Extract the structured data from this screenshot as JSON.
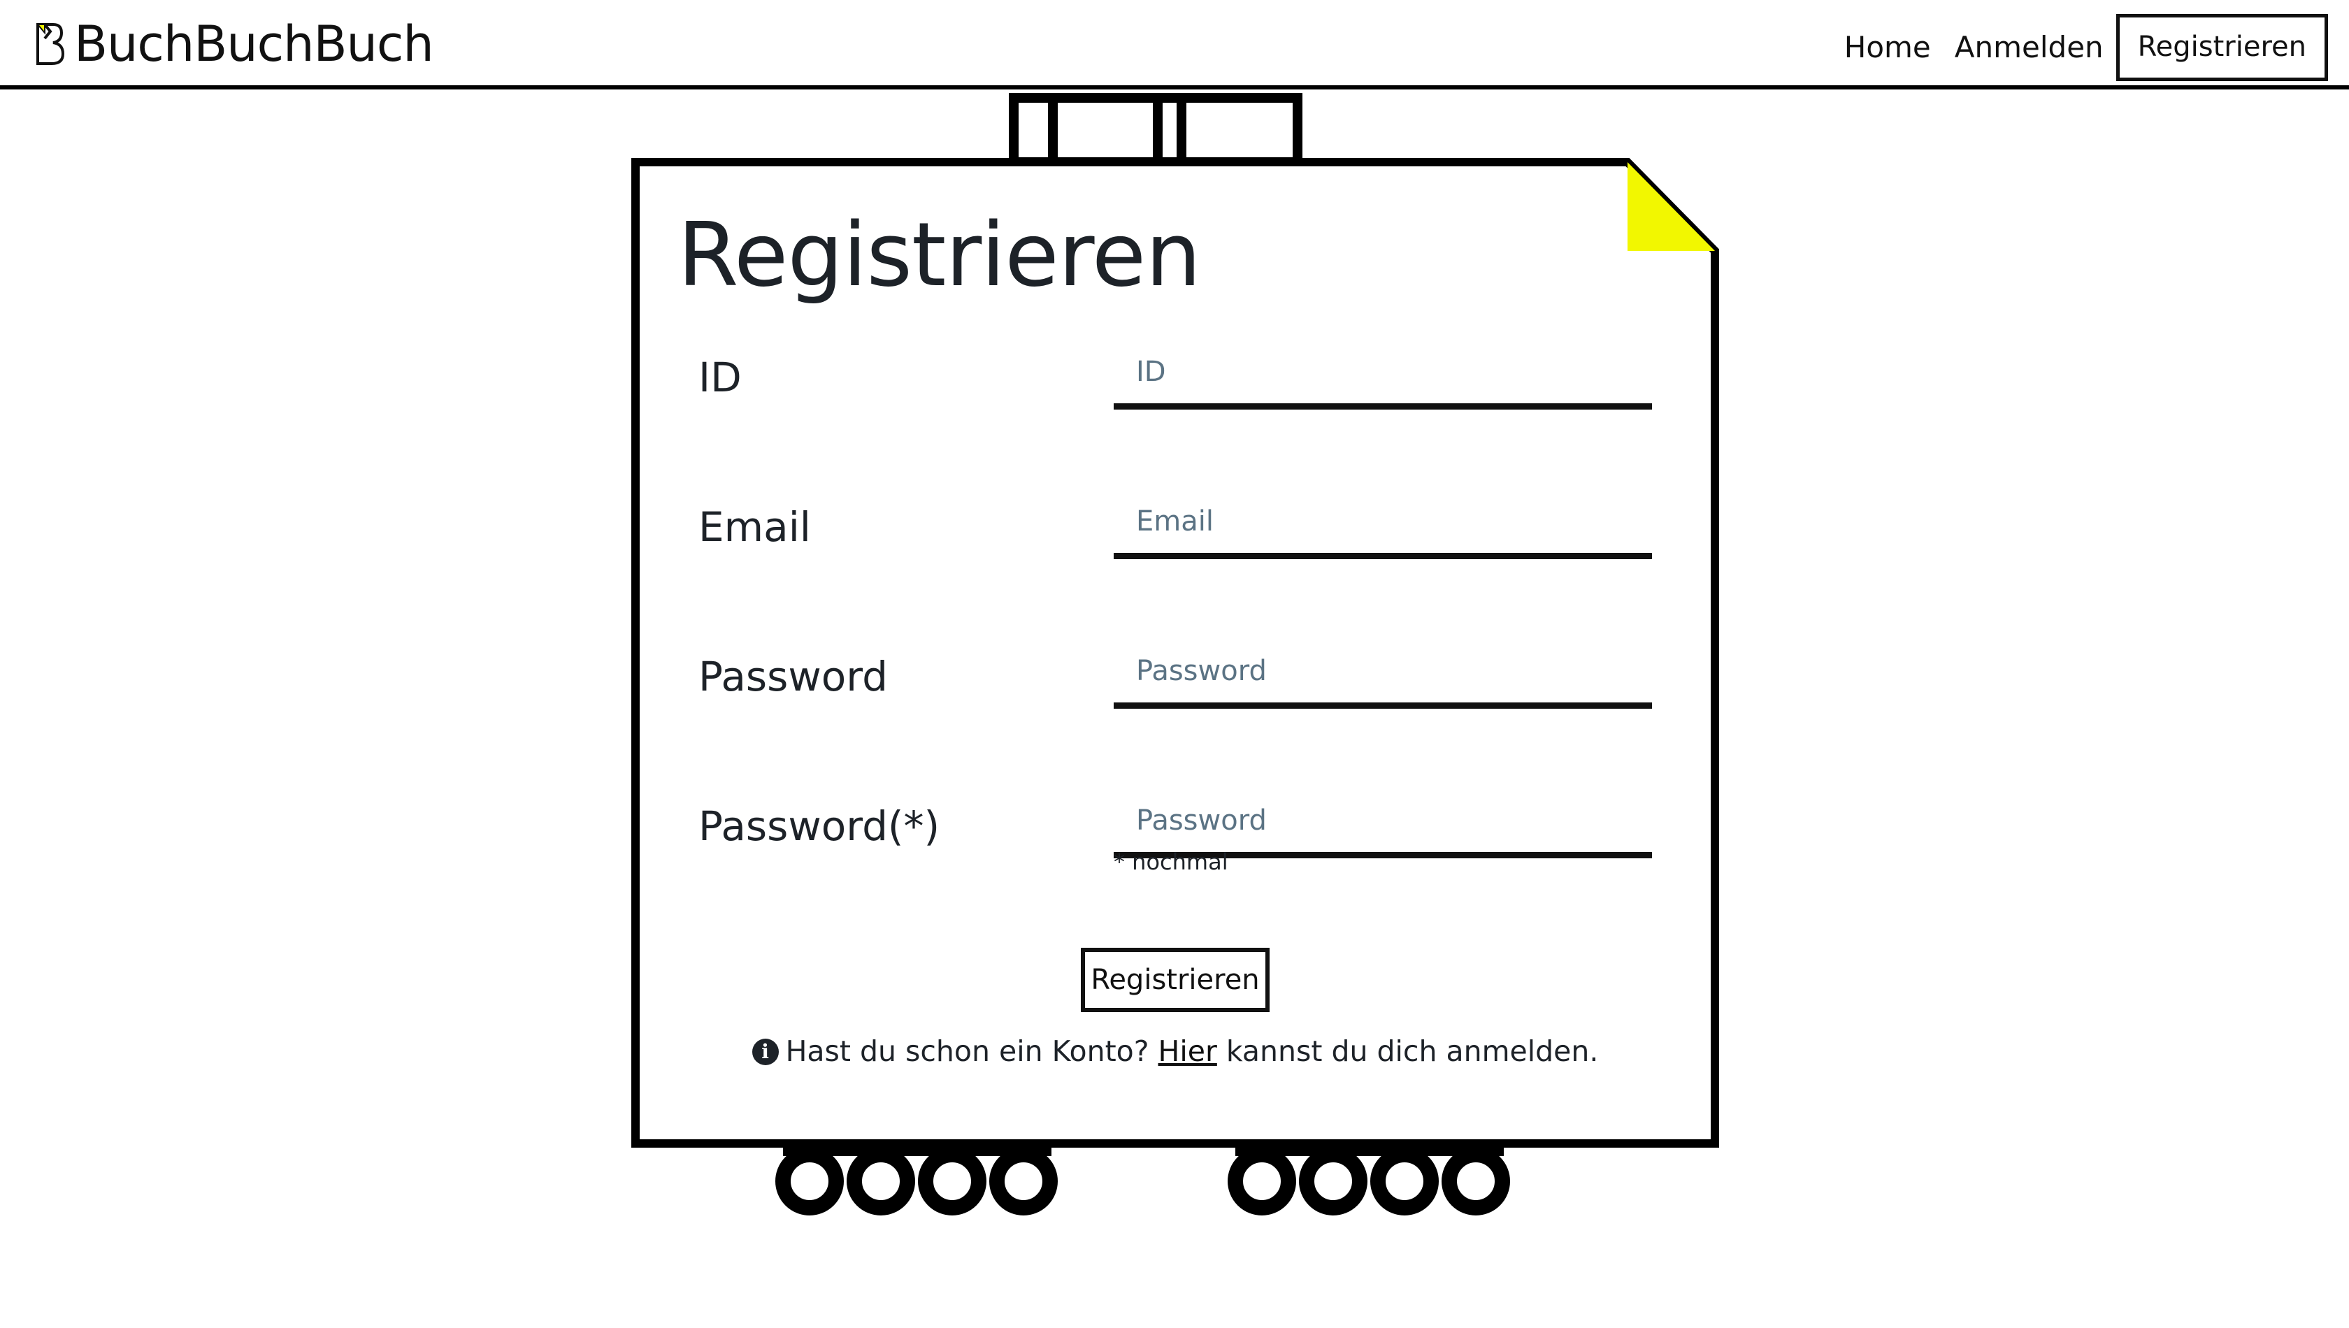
{
  "brand": {
    "name": "BuchBuchBuch"
  },
  "nav": {
    "home": "Home",
    "login": "Anmelden",
    "register": "Registrieren"
  },
  "form": {
    "title": "Registrieren",
    "fields": [
      {
        "label": "ID",
        "placeholder": "ID"
      },
      {
        "label": "Email",
        "placeholder": "Email"
      },
      {
        "label": "Password",
        "placeholder": "Password"
      },
      {
        "label": "Password(*)",
        "placeholder": "Password"
      }
    ],
    "hint": "* nochmal",
    "submit": "Registrieren",
    "info": {
      "before": "Hast du schon ein Konto? ",
      "link": "Hier",
      "after": " kannst du dich anmelden."
    }
  },
  "colors": {
    "corner_fold": "#f2f700",
    "outline": "#000000",
    "placeholder": "#5b7384"
  },
  "icons": {
    "brand": "book-b-icon",
    "info": "info-circle-icon"
  }
}
